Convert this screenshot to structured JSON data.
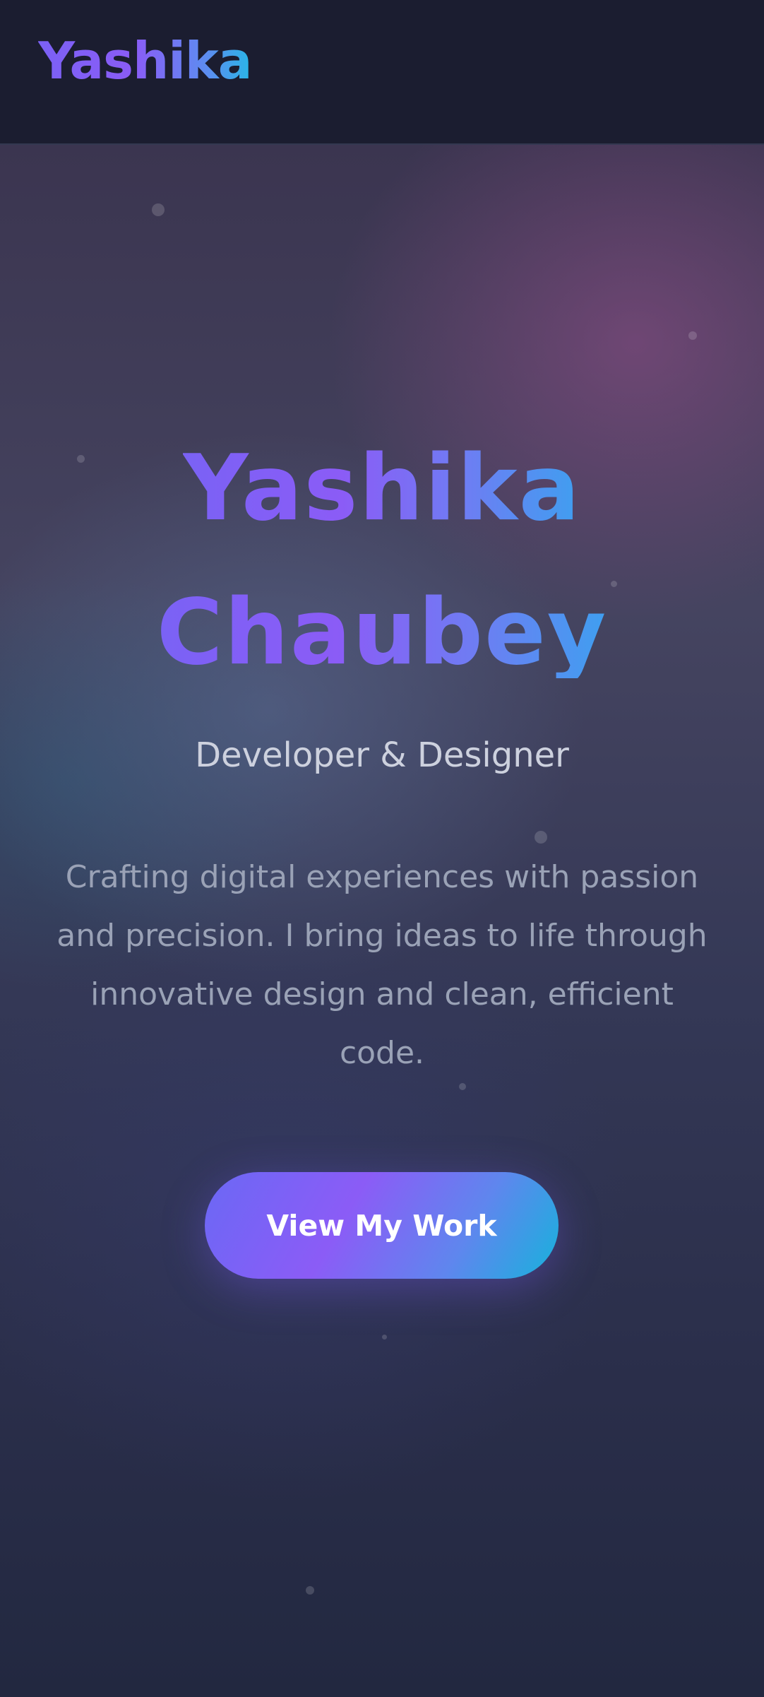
{
  "header": {
    "logo_text": "Yashika"
  },
  "hero": {
    "name_first": "Yashika",
    "name_last": "Chaubey",
    "subtitle": "Developer & Designer",
    "description": "Crafting digital experiences with passion and precision. I bring ideas to life through innovative design and clean, efficient code.",
    "cta_label": "View My Work"
  },
  "colors": {
    "header_bg": "#1b1d30",
    "gradient_start": "#7b61f5",
    "gradient_mid": "#8b5cf6",
    "gradient_end": "#17b2dc",
    "subtitle_text": "#cdd1de",
    "description_text": "#9aa2b6"
  }
}
